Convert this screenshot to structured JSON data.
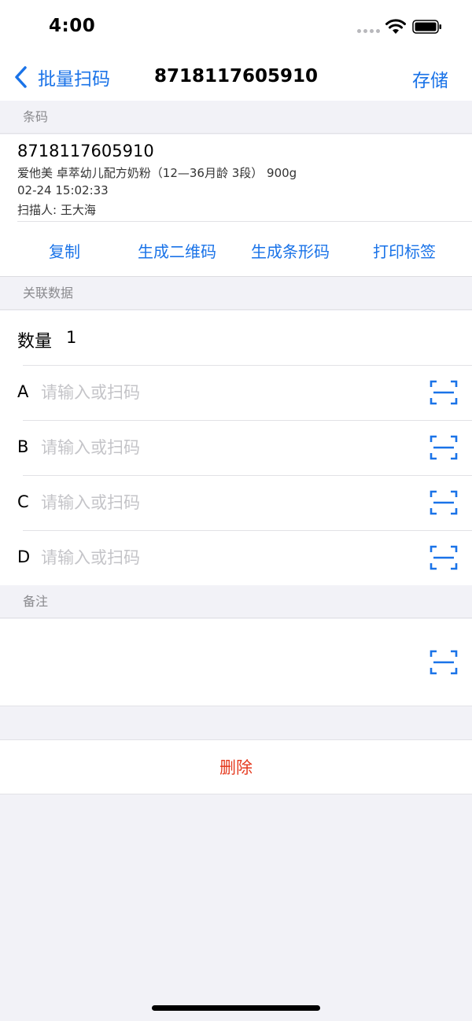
{
  "status_bar": {
    "time": "4:00"
  },
  "nav": {
    "back_label": "批量扫码",
    "title": "8718117605910",
    "save_label": "存储"
  },
  "sections": {
    "barcode": "条码",
    "related": "关联数据",
    "remark": "备注"
  },
  "barcode": {
    "number": "8718117605910",
    "product": "爱他美 卓萃幼儿配方奶粉（12—36月龄 3段） 900g",
    "time": "02-24 15:02:33",
    "scanner": "扫描人: 王大海"
  },
  "actions": {
    "copy": "复制",
    "qrcode": "生成二维码",
    "barcode": "生成条形码",
    "print": "打印标签"
  },
  "quantity": {
    "label": "数量",
    "value": "1"
  },
  "fields": [
    {
      "letter": "A",
      "placeholder": "请输入或扫码"
    },
    {
      "letter": "B",
      "placeholder": "请输入或扫码"
    },
    {
      "letter": "C",
      "placeholder": "请输入或扫码"
    },
    {
      "letter": "D",
      "placeholder": "请输入或扫码"
    }
  ],
  "delete_label": "删除",
  "colors": {
    "accent": "#1a73e8",
    "destructive": "#e53a1f",
    "background": "#f2f2f7"
  },
  "icons": {
    "back": "chevron-left-icon",
    "scan": "scan-icon",
    "wifi": "wifi-icon",
    "battery": "battery-icon"
  }
}
